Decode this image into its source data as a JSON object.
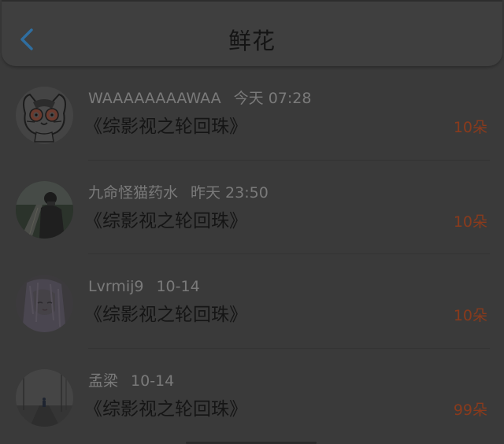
{
  "header": {
    "title": "鲜花",
    "back_icon": "chevron-left-icon",
    "back_color": "#2f6ea0"
  },
  "colors": {
    "amount": "#8a3a1c",
    "username": "#7a7a7a",
    "title_text": "#141414"
  },
  "items": [
    {
      "username": "WAAAAAAAAWAA",
      "time": "今天 07:28",
      "book": "《综影视之轮回珠》",
      "amount": "10朵",
      "avatar": "cartoon-cat-avatar"
    },
    {
      "username": "九命怪猫药水",
      "time": "昨天 23:50",
      "book": "《综影视之轮回珠》",
      "amount": "10朵",
      "avatar": "road-photo-avatar"
    },
    {
      "username": "Lvrmij9",
      "time": "10-14",
      "book": "《综影视之轮回珠》",
      "amount": "10朵",
      "avatar": "anime-girl-avatar"
    },
    {
      "username": "孟梁",
      "time": "10-14",
      "book": "《综影视之轮回珠》",
      "amount": "99朵",
      "avatar": "misty-road-avatar"
    }
  ]
}
